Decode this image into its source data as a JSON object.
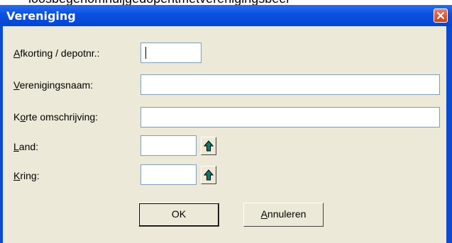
{
  "top_strip_text": "loosbegenomhuijgedopentmetverenigingsbeer",
  "window": {
    "title": "Vereniging",
    "close_icon": "close-icon"
  },
  "form": {
    "afkorting": {
      "mnemonic": "A",
      "rest": "fkorting / depotnr.:",
      "value": ""
    },
    "verenigingsnaam": {
      "mnemonic": "V",
      "rest": "erenigingsnaam:",
      "value": ""
    },
    "korte": {
      "pre": "K",
      "mnemonic": "o",
      "rest": "rte omschrijving:",
      "value": ""
    },
    "land": {
      "mnemonic": "L",
      "rest": "and:",
      "value": "",
      "lookup_icon": "arrow-up-icon"
    },
    "kring": {
      "mnemonic": "K",
      "rest": "ring:",
      "value": "",
      "lookup_icon": "arrow-up-icon"
    }
  },
  "buttons": {
    "ok": {
      "label": "OK"
    },
    "annuleren": {
      "mnemonic": "A",
      "rest": "nnuleren"
    }
  },
  "colors": {
    "titlebar": "#0a50e0",
    "dialog_bg": "#ece9d8",
    "arrow_icon": "#0b7a6a"
  }
}
